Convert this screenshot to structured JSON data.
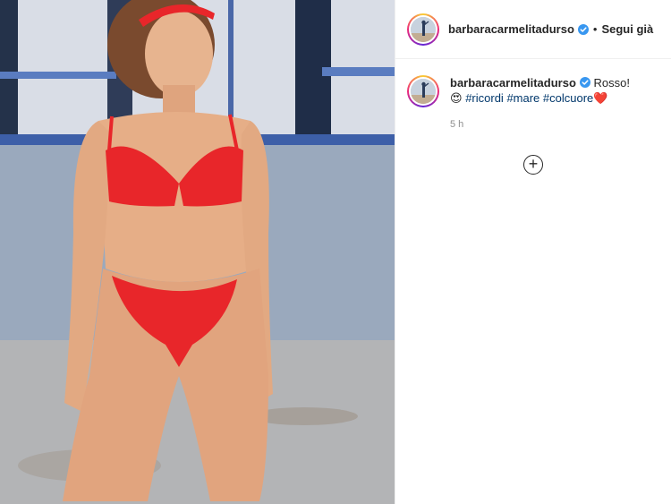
{
  "post": {
    "username": "barbaracarmelitadurso",
    "verified": true,
    "separator": "•",
    "follow_label": "Segui già",
    "caption": {
      "username": "barbaracarmelitadurso",
      "text": "Rosso!",
      "emoji": "😍",
      "hashtags": [
        "#ricordi",
        "#mare",
        "#colcuore"
      ],
      "trailing_emoji": "❤️"
    },
    "timestamp": "5 h"
  },
  "icons": {
    "verified": "verified-badge-icon",
    "load_more": "plus-circle-icon"
  },
  "colors": {
    "verified_blue": "#3897f0",
    "hashtag": "#00376b",
    "bikini_red": "#e8262a"
  },
  "media": {
    "description_alt": "Photo"
  }
}
